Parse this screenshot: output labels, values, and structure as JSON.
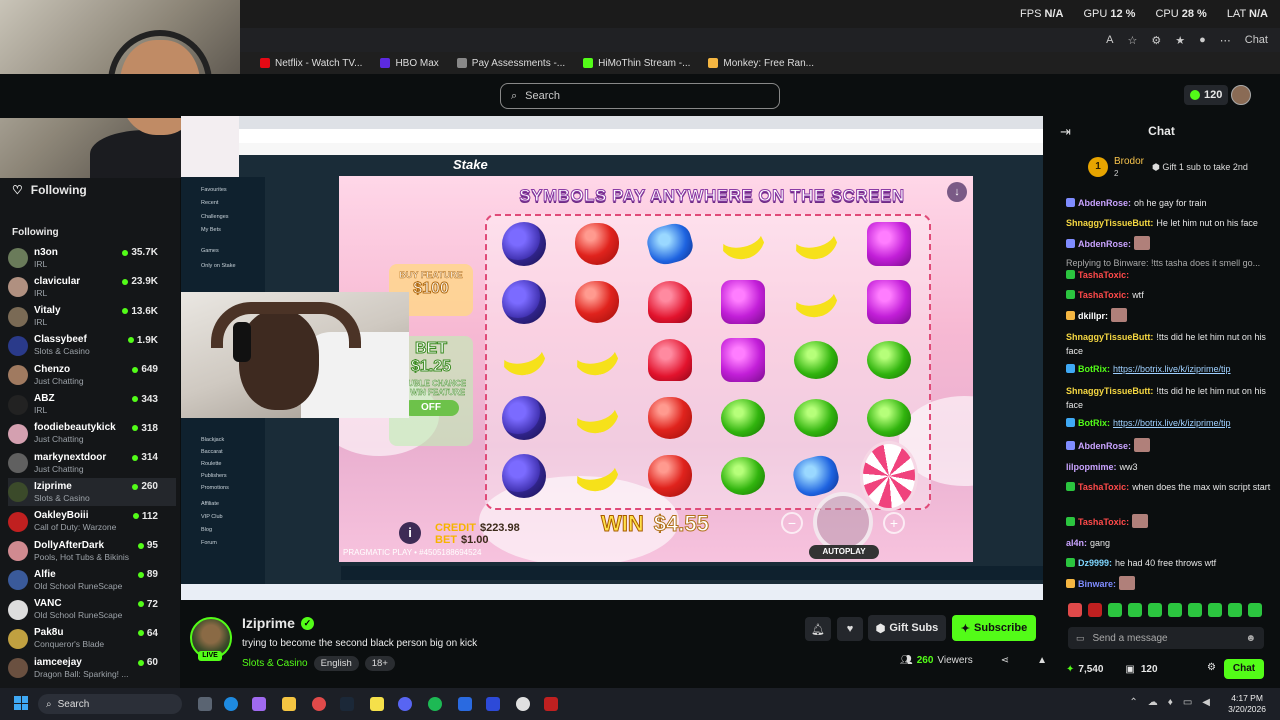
{
  "perf": {
    "fps_label": "FPS",
    "fps": "N/A",
    "gpu_label": "GPU",
    "gpu": "12 %",
    "cpu_label": "CPU",
    "cpu": "28 %",
    "lat_label": "LAT",
    "lat": "N/A"
  },
  "browser": {
    "chat_label": "Chat"
  },
  "bookmarks": [
    {
      "label": "Netflix - Watch TV...",
      "color": "#e50914"
    },
    {
      "label": "HBO Max",
      "color": "#5c2ae0"
    },
    {
      "label": "Pay Assessments -...",
      "color": "#888888"
    },
    {
      "label": "HiMoThin Stream -...",
      "color": "#53fc18"
    },
    {
      "label": "Monkey: Free Ran...",
      "color": "#f5b642"
    }
  ],
  "search": {
    "placeholder": "Search"
  },
  "topnav": {
    "kicks": "120"
  },
  "sidebar": {
    "header": "Following",
    "section": "Following",
    "channels": [
      {
        "name": "n3on",
        "category": "IRL",
        "viewers": "35.7K",
        "color": "#6a7b5a"
      },
      {
        "name": "clavicular",
        "category": "IRL",
        "viewers": "23.9K",
        "color": "#b09080"
      },
      {
        "name": "Vitaly",
        "category": "IRL",
        "viewers": "13.6K",
        "color": "#7a6a55"
      },
      {
        "name": "Classybeef",
        "category": "Slots & Casino",
        "viewers": "1.9K",
        "color": "#2a3a8a"
      },
      {
        "name": "Chenzo",
        "category": "Just Chatting",
        "viewers": "649",
        "color": "#a07a60"
      },
      {
        "name": "ABZ",
        "category": "IRL",
        "viewers": "343",
        "color": "#222222"
      },
      {
        "name": "foodiebeautykick",
        "category": "Just Chatting",
        "viewers": "318",
        "color": "#d4a0b0"
      },
      {
        "name": "markynextdoor",
        "category": "Just Chatting",
        "viewers": "314",
        "color": "#606060"
      },
      {
        "name": "Iziprime",
        "category": "Slots & Casino",
        "viewers": "260",
        "color": "#3b4a2a"
      },
      {
        "name": "OakleyBoiii",
        "category": "Call of Duty: Warzone",
        "viewers": "112",
        "color": "#c02020"
      },
      {
        "name": "DollyAfterDark",
        "category": "Pools, Hot Tubs & Bikinis",
        "viewers": "95",
        "color": "#d08a90"
      },
      {
        "name": "Alfie",
        "category": "Old School RuneScape",
        "viewers": "89",
        "color": "#3a5a9a"
      },
      {
        "name": "VANC",
        "category": "Old School RuneScape",
        "viewers": "72",
        "color": "#dddddd"
      },
      {
        "name": "Pak8u",
        "category": "Conqueror's Blade",
        "viewers": "64",
        "color": "#c0a040"
      },
      {
        "name": "iamceejay",
        "category": "Dragon Ball: Sparking! ...",
        "viewers": "60",
        "color": "#6a5040"
      }
    ]
  },
  "inner": {
    "stake_logo": "Stake",
    "nav": [
      "Favourites",
      "Recent",
      "Challenges",
      "My Bets",
      "Games",
      "Only on Stake",
      "Blackjack",
      "Baccarat",
      "Roulette",
      "Publishers",
      "Promotions",
      "Affiliate",
      "VIP Club",
      "Blog",
      "Forum"
    ]
  },
  "game": {
    "banner": "SYMBOLS PAY ANYWHERE ON THE SCREEN",
    "buy_feature": "BUY FEATURE",
    "buy_price": "$100",
    "bet_label": "BET",
    "bet_value": "$1.25",
    "double_chance": "DOUBLE CHANCE TO WIN FEATURE",
    "toggle": "OFF",
    "credit_label": "CREDIT",
    "credit": "$223.98",
    "bet_small_label": "BET",
    "bet_small": "$1.00",
    "win_label": "WIN",
    "win": "$4.55",
    "provider": "PRAGMATIC PLAY • #4505188694524",
    "autoplay": "AUTOPLAY",
    "grid": [
      [
        "grape",
        "apple",
        "blue",
        "banana",
        "banana",
        "purple"
      ],
      [
        "grape",
        "apple",
        "heart",
        "purple",
        "banana",
        "purple"
      ],
      [
        "banana",
        "banana",
        "heart",
        "purple",
        "green",
        "green"
      ],
      [
        "grape",
        "banana",
        "apple",
        "green",
        "green",
        "green"
      ],
      [
        "grape",
        "banana",
        "apple",
        "green",
        "blue",
        "lolli"
      ]
    ]
  },
  "chat": {
    "title": "Chat",
    "pinned": {
      "rank": "1",
      "name": "Brodor",
      "count": "2",
      "text": "Gift 1 sub to take 2nd"
    },
    "messages": [
      {
        "user": "AbdenRose:",
        "color": "#c9a3ff",
        "text": "oh he gay for train",
        "badge": "#7f8cff"
      },
      {
        "user": "ShnaggyTissueButt:",
        "color": "#f5d742",
        "text": "He let him nut on his face",
        "badge": ""
      },
      {
        "user": "AbdenRose:",
        "color": "#c9a3ff",
        "text": "",
        "badge": "#7f8cff",
        "emote": true
      },
      {
        "user": "",
        "color": "#aaaaaa",
        "text": "Replying to Binware: !tts tasha does it smell go...",
        "badge": ""
      },
      {
        "user": "TashaToxic:",
        "color": "#ff4a4a",
        "text": "",
        "badge": "#2bc53f"
      },
      {
        "user": "TashaToxic:",
        "color": "#ff4a4a",
        "text": "wtf",
        "badge": "#2bc53f"
      },
      {
        "user": "dkillpr:",
        "color": "#ffffff",
        "text": "",
        "badge": "#f5b642",
        "emote": true
      },
      {
        "user": "ShnaggyTissueButt:",
        "color": "#f5d742",
        "text": "!tts did he let him nut on his face",
        "badge": ""
      },
      {
        "user": "BotRix:",
        "color": "#53fc18",
        "link": "https://botrix.live/k/iziprime/tip",
        "badge": "#3fa9f5"
      },
      {
        "user": "ShnaggyTissueButt:",
        "color": "#f5d742",
        "text": "!tts did he let him nut on his face",
        "badge": ""
      },
      {
        "user": "BotRix:",
        "color": "#53fc18",
        "link": "https://botrix.live/k/iziprime/tip",
        "badge": "#3fa9f5"
      },
      {
        "user": "AbdenRose:",
        "color": "#c9a3ff",
        "text": "",
        "badge": "#7f8cff",
        "emote": true
      },
      {
        "user": "lilpopmime:",
        "color": "#c9a3ff",
        "text": "ww3",
        "badge": ""
      },
      {
        "user": "TashaToxic:",
        "color": "#ff4a4a",
        "text": "when does the max win script start",
        "badge": "#2bc53f"
      },
      {
        "user": "TashaToxic:",
        "color": "#ff4a4a",
        "text": "",
        "badge": "#2bc53f",
        "emote": true
      },
      {
        "user": "al4n:",
        "color": "#c9a3ff",
        "text": "gang",
        "badge": ""
      },
      {
        "user": "Dz9999:",
        "color": "#7fd6ff",
        "text": "he had 40 free throws wtf",
        "badge": "#2bc53f"
      },
      {
        "user": "Binware:",
        "color": "#7f8cff",
        "text": "",
        "badge": "#f5b642",
        "emote": true
      }
    ],
    "input_placeholder": "Send a message",
    "points": "7,540",
    "kicks": "120",
    "chat_button": "Chat"
  },
  "stream": {
    "name": "Iziprime",
    "live": "LIVE",
    "title": "trying to become the second black person big on kick",
    "category": "Slots & Casino",
    "tags": [
      "English",
      "18+"
    ],
    "gift_subs": "Gift Subs",
    "subscribe": "Subscribe",
    "viewers": "260",
    "viewers_label": "Viewers"
  },
  "taskbar": {
    "search": "Search",
    "time": "4:17 PM",
    "date": "3/20/2026"
  }
}
